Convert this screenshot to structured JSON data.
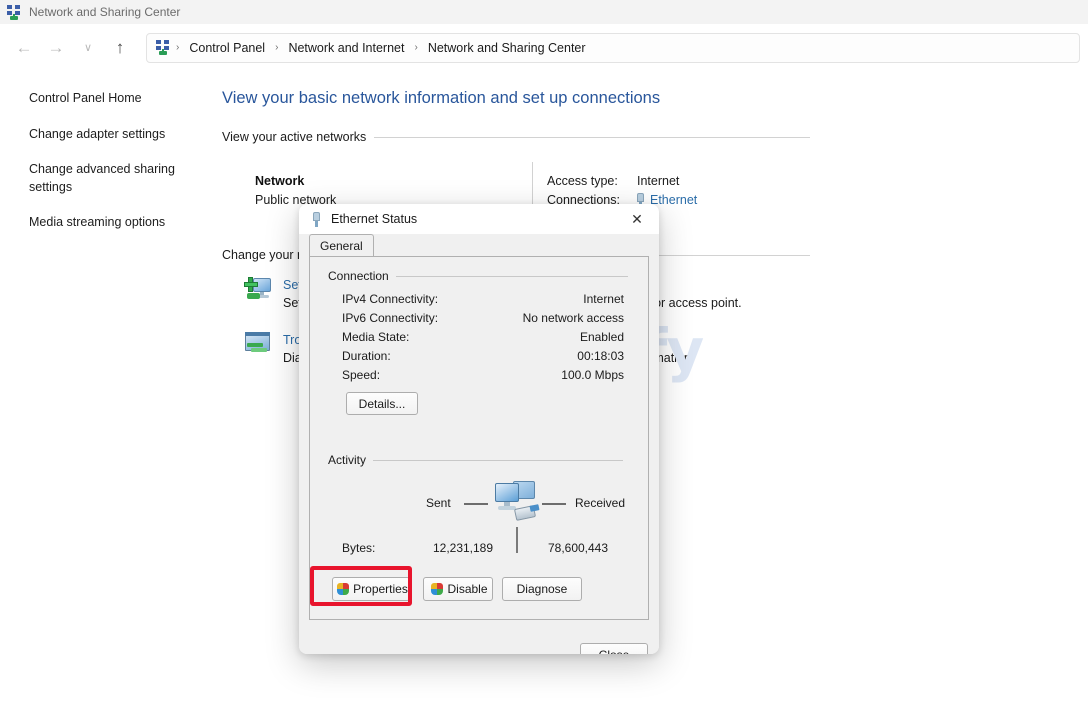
{
  "window": {
    "title": "Network and Sharing Center",
    "icon": "network-icon"
  },
  "nav": {
    "back": "←",
    "forward": "→",
    "recent": "∨",
    "up": "↑",
    "breadcrumb": [
      "Control Panel",
      "Network and Internet",
      "Network and Sharing Center"
    ],
    "separator": "›"
  },
  "sidebar": {
    "items": [
      {
        "label": "Control Panel Home"
      },
      {
        "label": "Change adapter settings"
      },
      {
        "label": "Change advanced sharing settings"
      },
      {
        "label": "Media streaming options"
      }
    ]
  },
  "main": {
    "heading": "View your basic network information and set up connections",
    "active_networks_label": "View your active networks",
    "network": {
      "name": "Network",
      "type": "Public network",
      "access_type_label": "Access type:",
      "access_type_value": "Internet",
      "connections_label": "Connections:",
      "connections_value": "Ethernet"
    },
    "change_settings_label": "Change your networking settings",
    "items": [
      {
        "title": "Set up a new connection or network",
        "desc": "Set up a broadband, dial-up, or VPN connection; or set up a router or access point.",
        "icon": "setup-connection-icon"
      },
      {
        "title": "Troubleshoot problems",
        "desc": "Diagnose and repair network problems, or get troubleshooting information.",
        "icon": "troubleshoot-icon"
      }
    ]
  },
  "watermark": {
    "text": "Uplarify"
  },
  "dialog": {
    "title": "Ethernet Status",
    "icon": "ethernet-plug-icon",
    "close": "✕",
    "tab": "General",
    "connection": {
      "group_label": "Connection",
      "rows": [
        {
          "label": "IPv4 Connectivity:",
          "value": "Internet"
        },
        {
          "label": "IPv6 Connectivity:",
          "value": "No network access"
        },
        {
          "label": "Media State:",
          "value": "Enabled"
        },
        {
          "label": "Duration:",
          "value": "00:18:03"
        },
        {
          "label": "Speed:",
          "value": "100.0 Mbps"
        }
      ],
      "details_button": "Details..."
    },
    "activity": {
      "group_label": "Activity",
      "sent_label": "Sent",
      "received_label": "Received",
      "bytes_label": "Bytes:",
      "bytes_sent": "12,231,189",
      "bytes_received": "78,600,443"
    },
    "buttons": {
      "properties": "Properties",
      "disable": "Disable",
      "diagnose": "Diagnose",
      "close": "Close"
    },
    "highlight_color": "#e8142d"
  }
}
